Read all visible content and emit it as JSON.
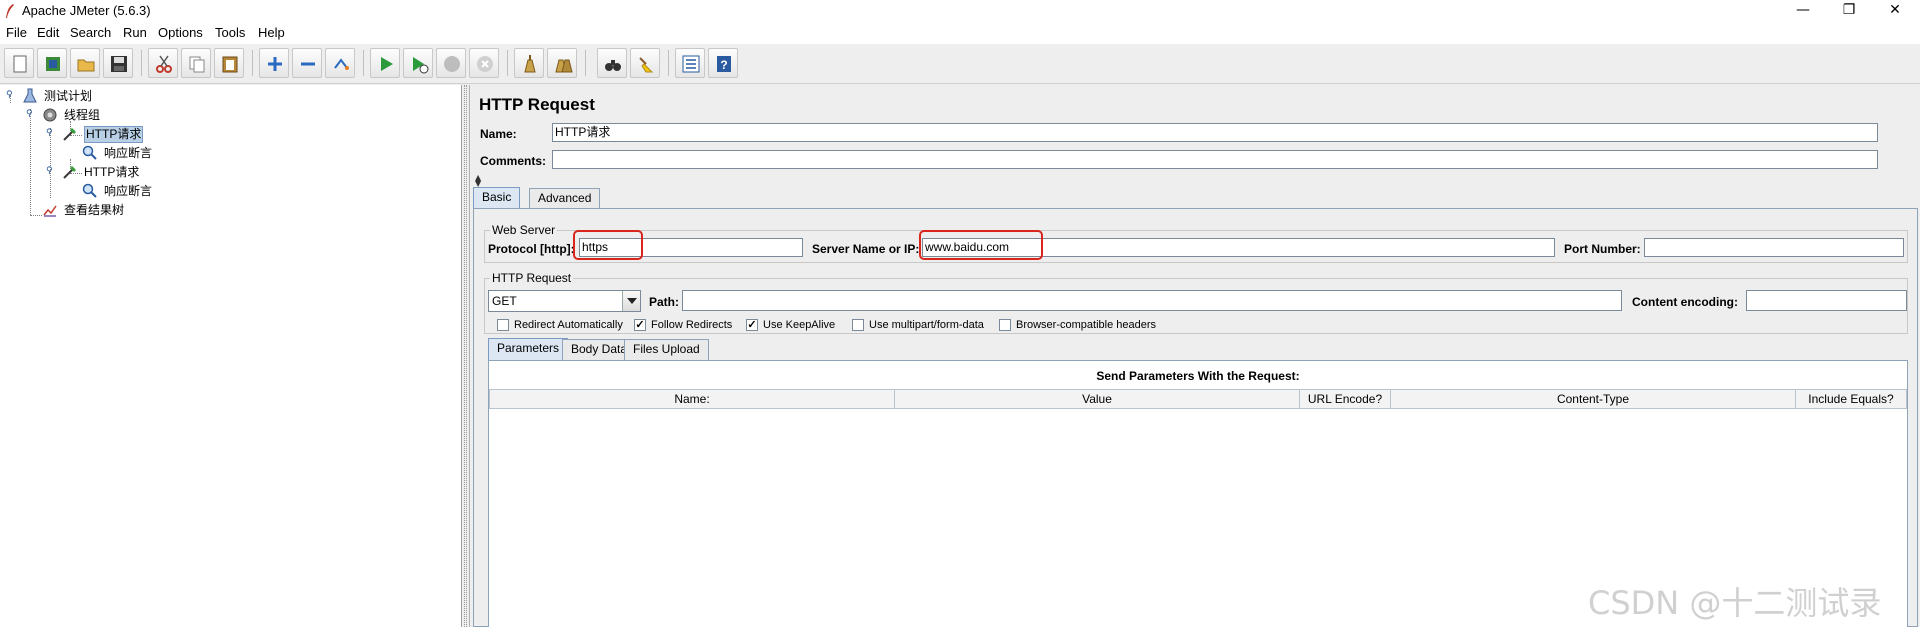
{
  "window": {
    "title": "Apache JMeter (5.6.3)",
    "minimize_glyph": "—",
    "maximize_glyph": "❐",
    "close_glyph": "✕"
  },
  "menu": [
    "File",
    "Edit",
    "Search",
    "Run",
    "Options",
    "Tools",
    "Help"
  ],
  "toolbar": {
    "icons": [
      "new-icon",
      "templates-icon",
      "open-icon",
      "save-icon",
      "cut-icon",
      "copy-icon",
      "paste-icon",
      "expand-icon",
      "collapse-icon",
      "toggle-icon",
      "start-icon",
      "start-no-timers-icon",
      "stop-icon",
      "shutdown-icon",
      "clear-icon",
      "clear-all-icon",
      "search-icon",
      "reset-search-icon",
      "function-helper-icon",
      "help-icon"
    ]
  },
  "tree": {
    "nodes": [
      {
        "label": "测试计划",
        "icon": "test-plan-icon",
        "level": 0
      },
      {
        "label": "线程组",
        "icon": "thread-group-icon",
        "level": 1
      },
      {
        "label": "HTTP请求",
        "icon": "http-sampler-icon",
        "level": 2,
        "selected": true
      },
      {
        "label": "响应断言",
        "icon": "assertion-icon",
        "level": 3
      },
      {
        "label": "HTTP请求",
        "icon": "http-sampler-icon",
        "level": 2
      },
      {
        "label": "响应断言",
        "icon": "assertion-icon",
        "level": 3
      },
      {
        "label": "查看结果树",
        "icon": "results-tree-icon",
        "level": 1
      }
    ]
  },
  "panel": {
    "title": "HTTP Request",
    "name_label": "Name:",
    "name_value": "HTTP请求",
    "comments_label": "Comments:",
    "comments_value": ""
  },
  "tabs": {
    "main": [
      "Basic",
      "Advanced"
    ],
    "active_main": "Basic",
    "sub": [
      "Parameters",
      "Body Data",
      "Files Upload"
    ],
    "active_sub": "Parameters"
  },
  "web_server": {
    "title": "Web Server",
    "protocol_label": "Protocol [http]:",
    "protocol_value": "https",
    "server_label": "Server Name or IP:",
    "server_value": "www.baidu.com",
    "port_label": "Port Number:",
    "port_value": ""
  },
  "http_request": {
    "title": "HTTP Request",
    "method": "GET",
    "path_label": "Path:",
    "path_value": "",
    "encoding_label": "Content encoding:",
    "encoding_value": ""
  },
  "options": [
    {
      "label": "Redirect Automatically",
      "checked": false
    },
    {
      "label": "Follow Redirects",
      "checked": true
    },
    {
      "label": "Use KeepAlive",
      "checked": true
    },
    {
      "label": "Use multipart/form-data",
      "checked": false
    },
    {
      "label": "Browser-compatible headers",
      "checked": false
    }
  ],
  "params_table": {
    "caption": "Send Parameters With the Request:",
    "columns": [
      "Name:",
      "Value",
      "URL Encode?",
      "Content-Type",
      "Include Equals?"
    ]
  },
  "watermark": "CSDN @十二测试录",
  "colors": {
    "highlight_box": "#d9261c",
    "selection": "#b8cfe5"
  }
}
